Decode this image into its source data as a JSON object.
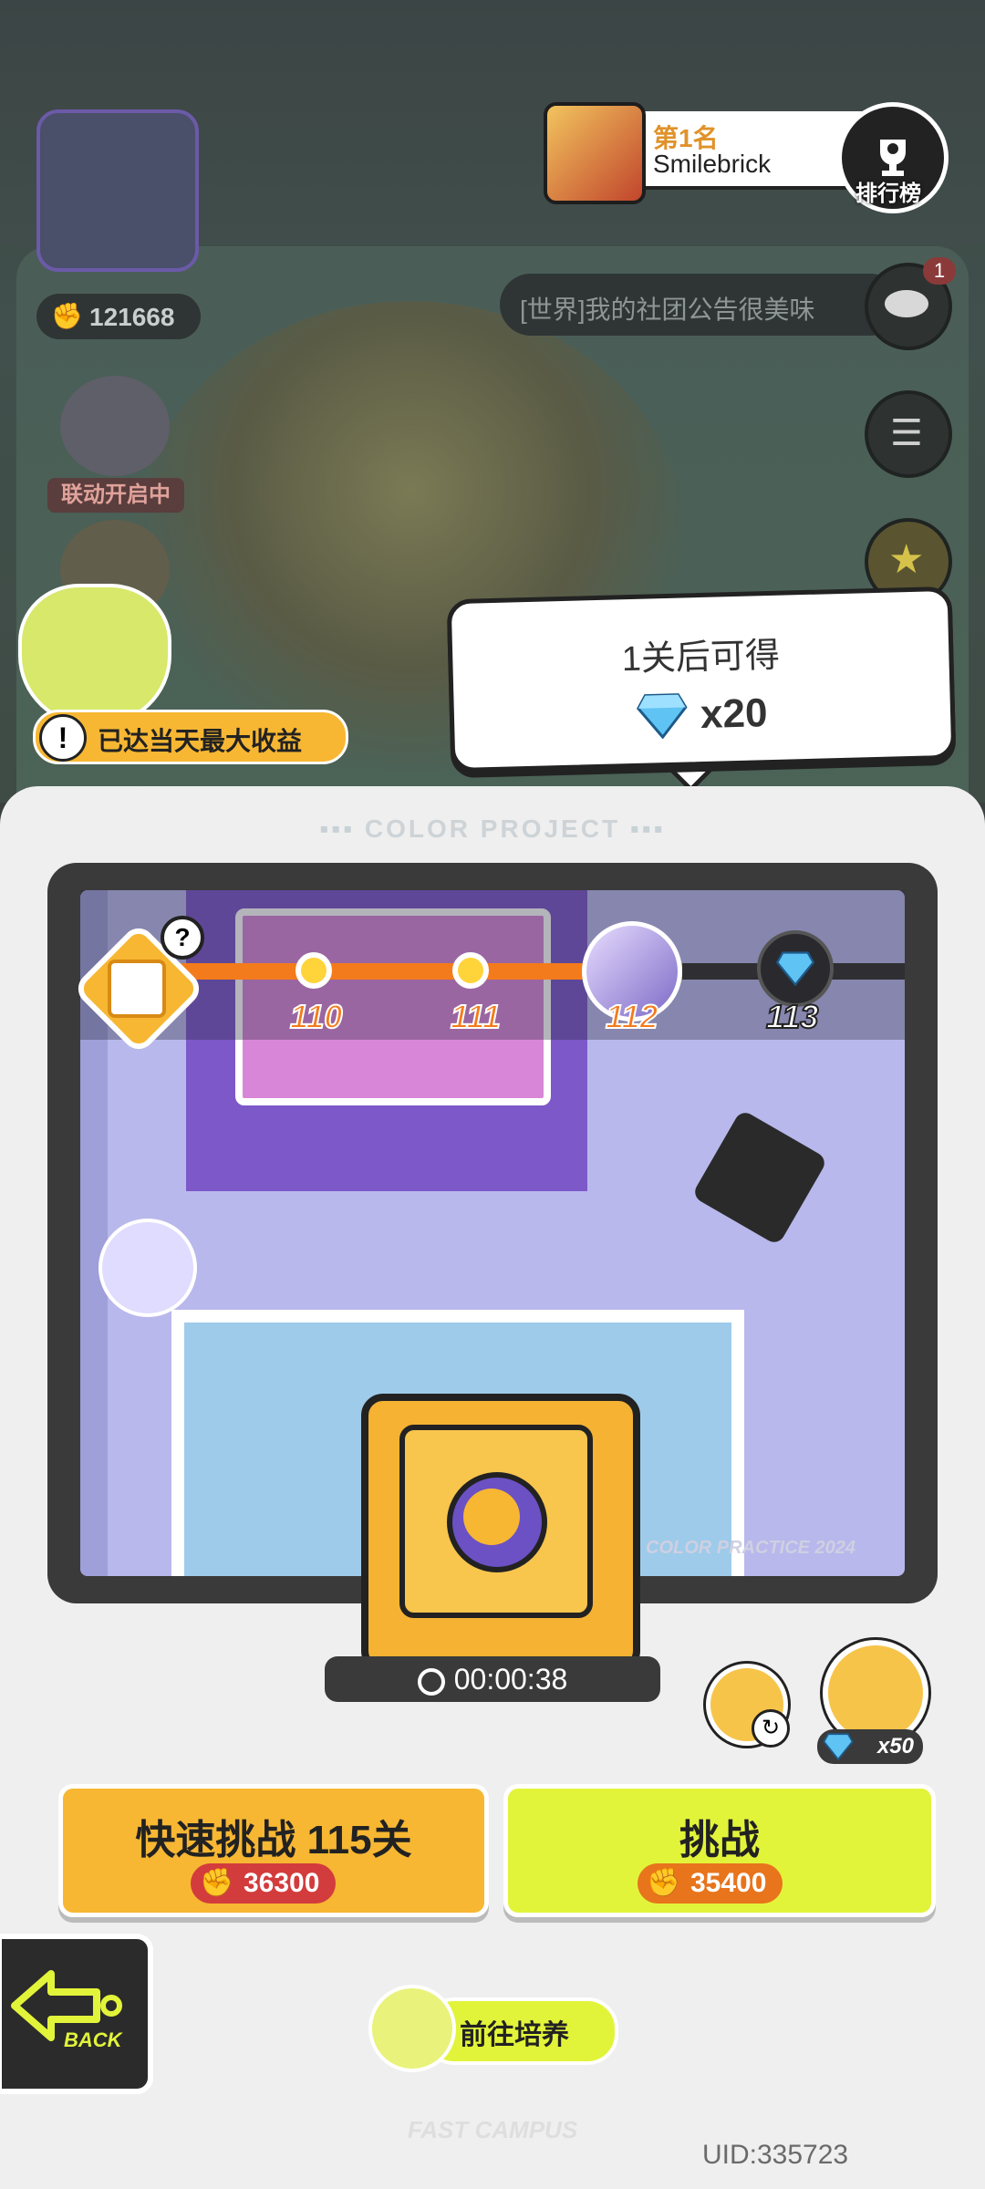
{
  "header": {
    "rank_title": "第1名",
    "rank_name": "Smilebrick",
    "leaderboard_label": "排行榜"
  },
  "sidebar": {
    "power_value": "121668",
    "event_label": "联动开启中",
    "chat_text": "[世界]我的社团公告很美味",
    "chat_badge": "1",
    "max_earnings_notice": "已达当天最大收益"
  },
  "tooltip": {
    "title": "1关后可得",
    "reward": "x20"
  },
  "panel": {
    "title": "COLOR PROJECT",
    "footer_brand": "FAST CAMPUS",
    "watermark": "COLOR PRACTICE 2024"
  },
  "progress": {
    "levels": [
      "110",
      "111",
      "112",
      "113"
    ],
    "current_level_index": 2,
    "fill_fraction": 0.7
  },
  "timer": "00:00:38",
  "clock_gem_cost": "x50",
  "actions": {
    "quick_label": "快速挑战 115关",
    "quick_cost": "36300",
    "challenge_label": "挑战",
    "challenge_cost": "35400"
  },
  "back_label": "BACK",
  "train_label": "前往培养",
  "uid": "UID:335723",
  "colors": {
    "accent_orange": "#f47b1c",
    "accent_yellow": "#f7b733",
    "accent_lime": "#e2f43a",
    "cost_red": "#d33c3c"
  }
}
